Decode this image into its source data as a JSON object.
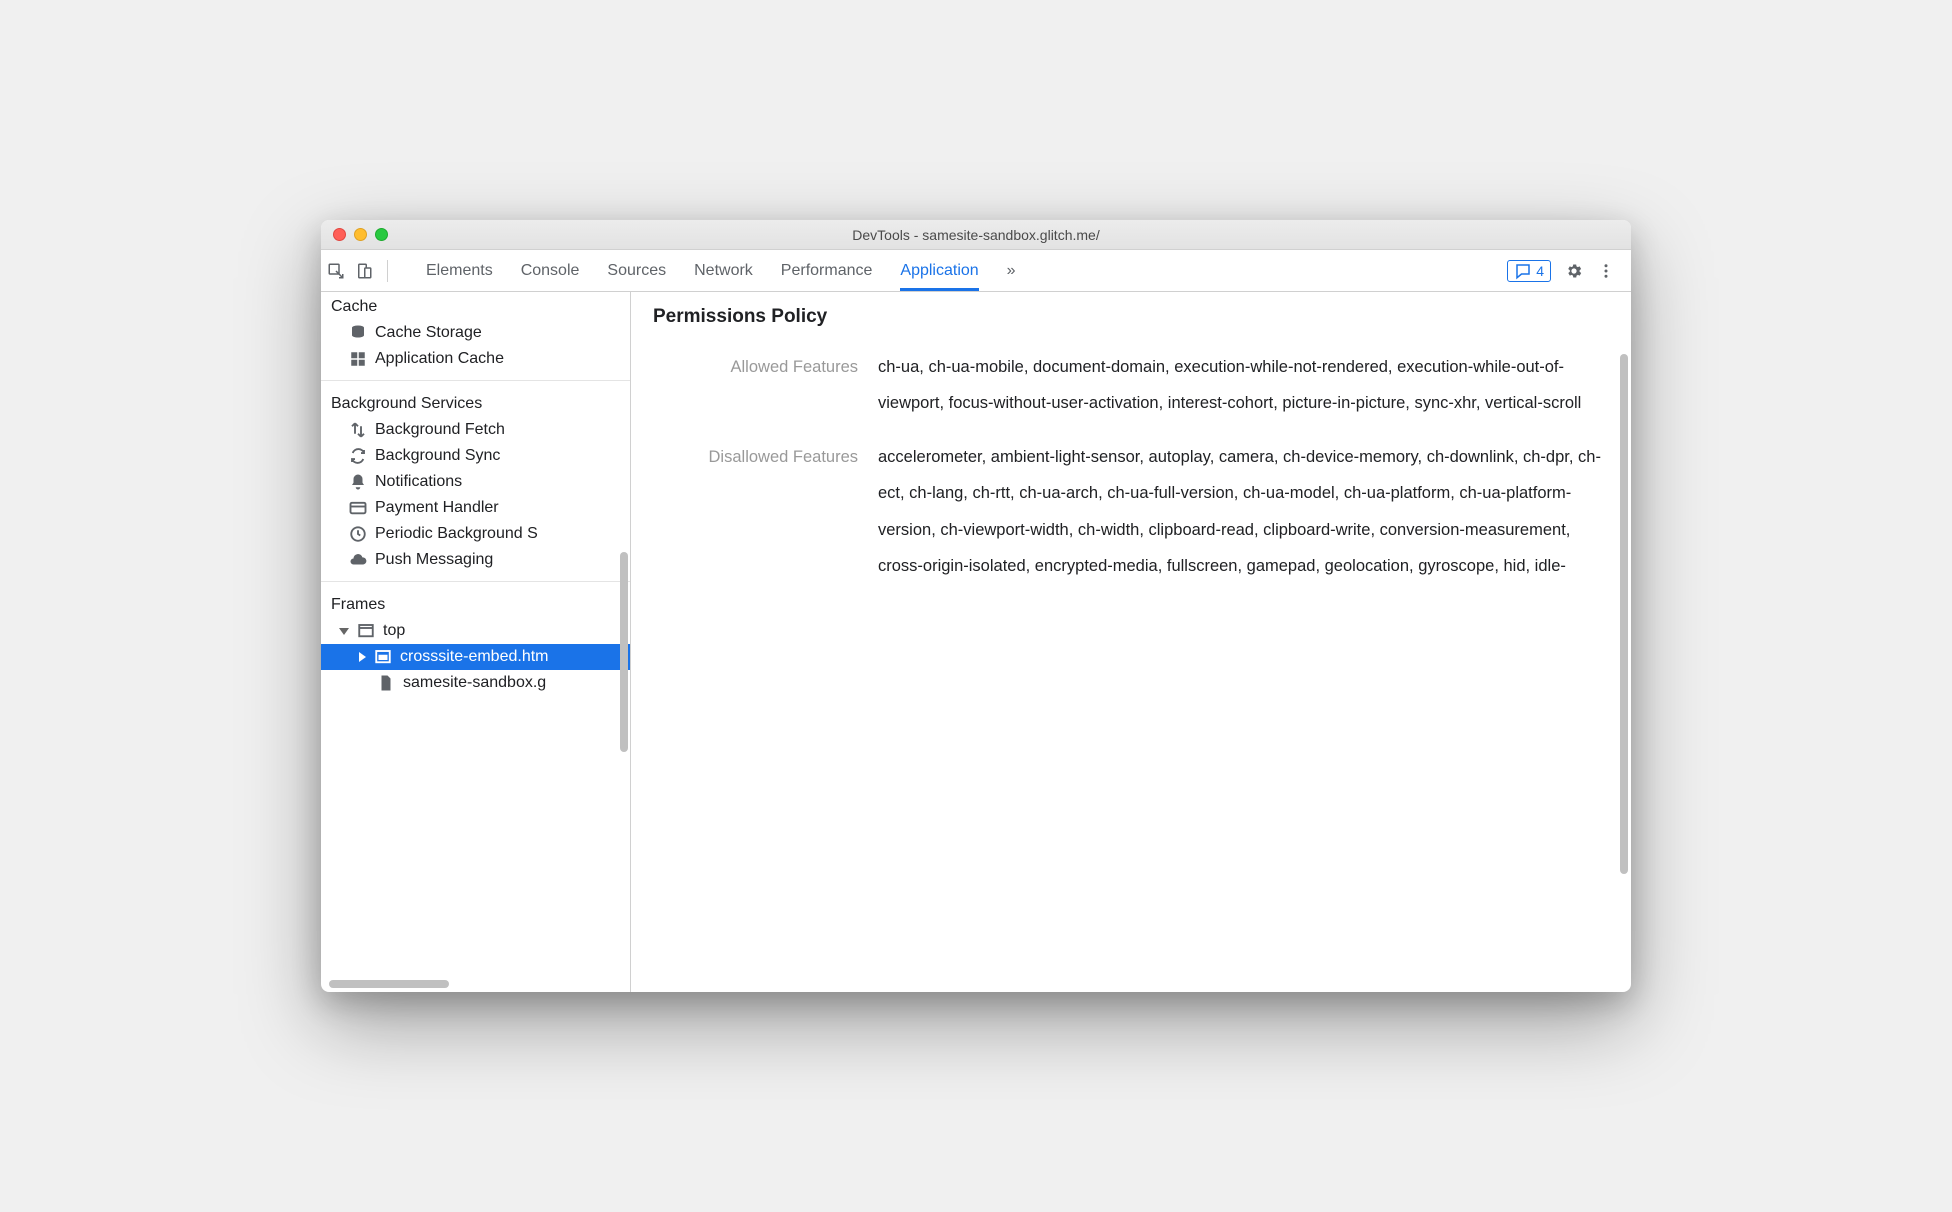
{
  "window": {
    "title": "DevTools - samesite-sandbox.glitch.me/"
  },
  "tabs": {
    "items": [
      "Elements",
      "Console",
      "Sources",
      "Network",
      "Performance",
      "Application"
    ],
    "active_index": 5,
    "overflow_glyph": "»",
    "issue_count": "4"
  },
  "sidebar": {
    "sections": [
      {
        "title": "Cache",
        "items": [
          {
            "icon": "db",
            "label": "Cache Storage"
          },
          {
            "icon": "grid",
            "label": "Application Cache"
          }
        ]
      },
      {
        "title": "Background Services",
        "items": [
          {
            "icon": "arrows",
            "label": "Background Fetch"
          },
          {
            "icon": "sync",
            "label": "Background Sync"
          },
          {
            "icon": "bell",
            "label": "Notifications"
          },
          {
            "icon": "card",
            "label": "Payment Handler"
          },
          {
            "icon": "clock",
            "label": "Periodic Background S"
          },
          {
            "icon": "cloud",
            "label": "Push Messaging"
          }
        ]
      },
      {
        "title": "Frames",
        "tree": {
          "root": {
            "label": "top"
          },
          "child_selected": {
            "label": "crosssite-embed.htm"
          },
          "leaf": {
            "label": "samesite-sandbox.g"
          }
        }
      }
    ]
  },
  "main": {
    "heading": "Permissions Policy",
    "rows": [
      {
        "label": "Allowed Features",
        "value": "ch-ua, ch-ua-mobile, document-domain, execution-while-not-rendered, execution-while-out-of-viewport, focus-without-user-activation, interest-cohort, picture-in-picture, sync-xhr, vertical-scroll"
      },
      {
        "label": "Disallowed Features",
        "value": "accelerometer, ambient-light-sensor, autoplay, camera, ch-device-memory, ch-downlink, ch-dpr, ch-ect, ch-lang, ch-rtt, ch-ua-arch, ch-ua-full-version, ch-ua-model, ch-ua-platform, ch-ua-platform-version, ch-viewport-width, ch-width, clipboard-read, clipboard-write, conversion-measurement, cross-origin-isolated, encrypted-media, fullscreen, gamepad, geolocation, gyroscope, hid, idle-"
      }
    ]
  }
}
